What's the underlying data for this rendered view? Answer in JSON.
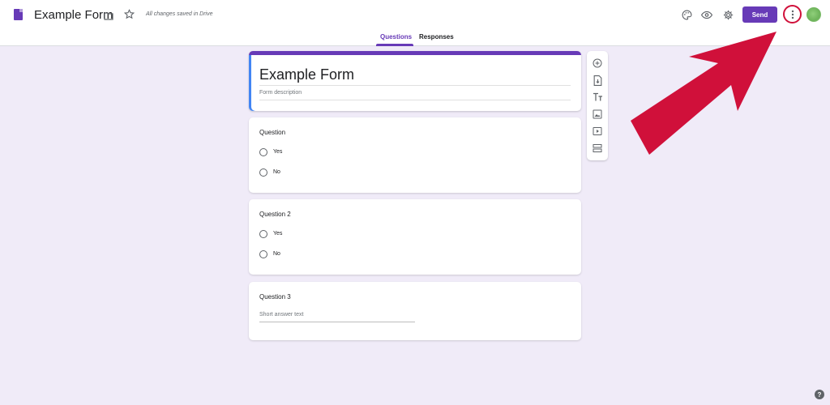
{
  "header": {
    "doc_title": "Example Form",
    "saved_status": "All changes saved in Drive",
    "send_label": "Send",
    "icons": [
      "forms-logo-icon",
      "folder-icon",
      "star-icon",
      "palette-icon",
      "eye-icon",
      "gear-icon",
      "more-vert-icon",
      "avatar"
    ]
  },
  "tabs": [
    {
      "label": "Questions",
      "active": true
    },
    {
      "label": "Responses",
      "active": false
    }
  ],
  "form": {
    "title": "Example Form",
    "description_placeholder": "Form description",
    "questions": [
      {
        "title": "Question",
        "type": "multiple-choice",
        "options": [
          "Yes",
          "No"
        ]
      },
      {
        "title": "Question 2",
        "type": "multiple-choice",
        "options": [
          "Yes",
          "No"
        ]
      },
      {
        "title": "Question 3",
        "type": "short-answer",
        "placeholder": "Short answer text"
      }
    ]
  },
  "toolbar": {
    "tools": [
      "add-question-icon",
      "import-questions-icon",
      "add-title-icon",
      "add-image-icon",
      "add-video-icon",
      "add-section-icon"
    ]
  },
  "help": {
    "label": "?"
  },
  "colors": {
    "accent": "#673ab7",
    "background": "#f0ebf8",
    "annotation": "#d0103a",
    "focus_bar": "#4285f4"
  }
}
